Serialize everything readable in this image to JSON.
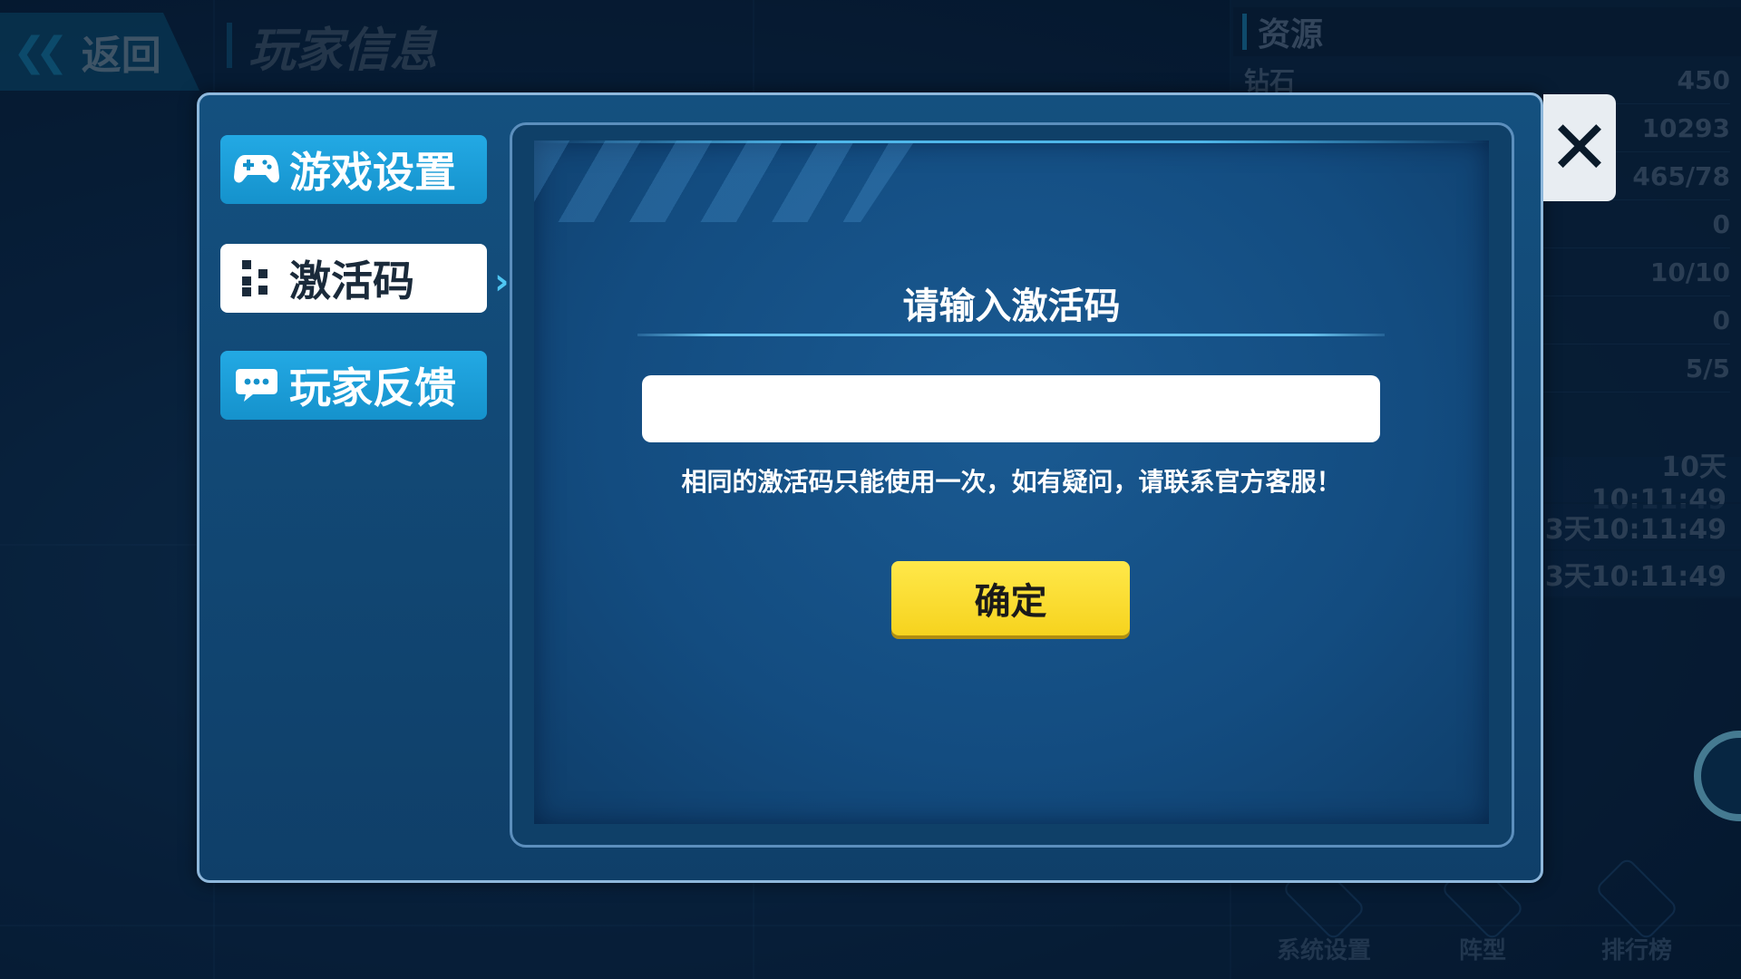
{
  "background": {
    "back_label": "返回",
    "page_title": "玩家信息",
    "resources_header": "资源",
    "resources": [
      {
        "label": "钻石",
        "value": "450"
      },
      {
        "label": "",
        "value": "10293"
      },
      {
        "label": "",
        "value": "465/78"
      },
      {
        "label": "",
        "value": "0"
      },
      {
        "label": "",
        "value": "10/10"
      },
      {
        "label": "",
        "value": "0"
      },
      {
        "label": "",
        "value": "5/5"
      }
    ],
    "timers": [
      "10天10:11:49",
      "3天10:11:49",
      "3天10:11:49"
    ],
    "bottom_nav": [
      "系统设置",
      "阵型",
      "排行榜"
    ]
  },
  "modal": {
    "close_symbol": "✕",
    "tabs": [
      {
        "label": "游戏设置",
        "icon": "gamepad-icon",
        "active": false
      },
      {
        "label": "激活码",
        "icon": "code-icon",
        "active": true
      },
      {
        "label": "玩家反馈",
        "icon": "chat-bubble-icon",
        "active": false
      }
    ],
    "activation": {
      "title": "请输入激活码",
      "input_value": "",
      "hint": "相同的激活码只能使用一次，如有疑问，请联系官方客服！",
      "confirm_label": "确定"
    }
  },
  "colors": {
    "accent_blue": "#1b9ed2",
    "confirm_yellow": "#ffe84a",
    "modal_bg": "#14507f"
  }
}
